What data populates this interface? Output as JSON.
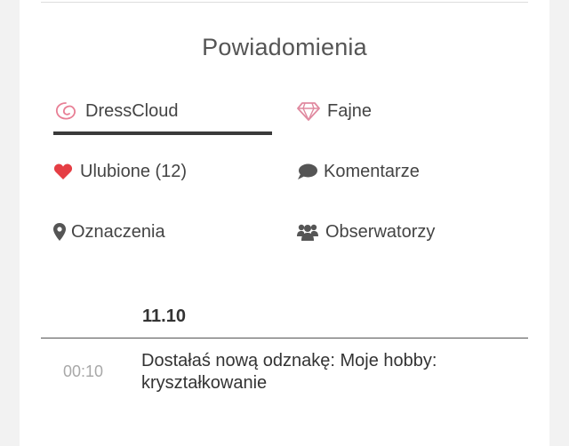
{
  "title": "Powiadomienia",
  "colors": {
    "active_underline": "#3a3a3a",
    "heart": "#e53e44",
    "diamond": "#e08aa0",
    "logo": "#e87f95",
    "icon_gray": "#555555"
  },
  "tabs": [
    {
      "label": "DressCloud",
      "icon": "dresscloud-logo-icon",
      "active": true
    },
    {
      "label": "Fajne",
      "icon": "diamond-icon",
      "active": false
    },
    {
      "label": "Ulubione (12)",
      "icon": "heart-icon",
      "active": false
    },
    {
      "label": "Komentarze",
      "icon": "comment-icon",
      "active": false
    },
    {
      "label": "Oznaczenia",
      "icon": "map-pin-icon",
      "active": false
    },
    {
      "label": "Obserwatorzy",
      "icon": "users-icon",
      "active": false
    }
  ],
  "feed": {
    "date": "11.10",
    "items": [
      {
        "time": "00:10",
        "text": "Dostałaś nową odznakę: Moje hobby: kryształkowanie"
      }
    ]
  }
}
